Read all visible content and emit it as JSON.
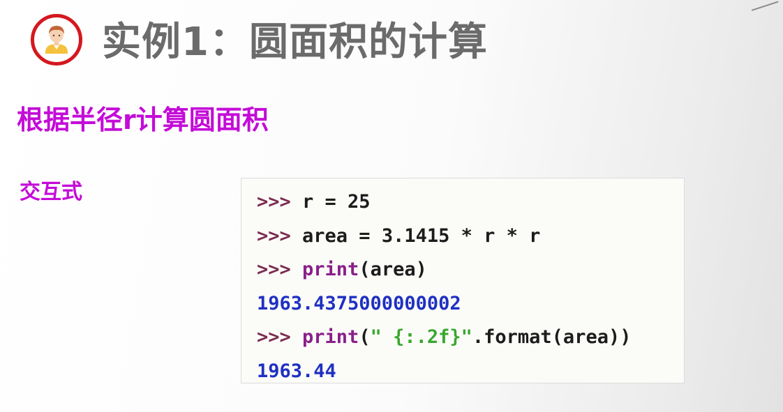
{
  "slide": {
    "title": "实例1：圆面积的计算",
    "subtitle": "根据半径r计算圆面积",
    "mode_label": "交互式"
  },
  "avatar": {
    "icon": "person-avatar-icon",
    "ring_color": "#d4181f"
  },
  "code": {
    "lines": [
      {
        "type": "input",
        "tokens": [
          {
            "kind": "prompt",
            "text": ">>> "
          },
          {
            "kind": "plain",
            "text": "r = 25"
          }
        ]
      },
      {
        "type": "input",
        "tokens": [
          {
            "kind": "prompt",
            "text": ">>> "
          },
          {
            "kind": "plain",
            "text": "area = 3.1415 * r * r"
          }
        ]
      },
      {
        "type": "input",
        "tokens": [
          {
            "kind": "prompt",
            "text": ">>> "
          },
          {
            "kind": "func",
            "text": "print"
          },
          {
            "kind": "plain",
            "text": "(area)"
          }
        ]
      },
      {
        "type": "output",
        "tokens": [
          {
            "kind": "output",
            "text": "1963.4375000000002"
          }
        ]
      },
      {
        "type": "input",
        "tokens": [
          {
            "kind": "prompt",
            "text": ">>> "
          },
          {
            "kind": "func",
            "text": "print"
          },
          {
            "kind": "plain",
            "text": "("
          },
          {
            "kind": "string",
            "text": "\" {:.2f}\""
          },
          {
            "kind": "plain",
            "text": ".format(area))"
          }
        ]
      },
      {
        "type": "output",
        "tokens": [
          {
            "kind": "output",
            "text": "1963.44"
          }
        ]
      }
    ]
  },
  "colors": {
    "title": "#6b6b6b",
    "accent": "#c40bd8",
    "prompt": "#7b2b50",
    "function": "#8a1f8a",
    "string": "#3aa72f",
    "output": "#1f30c2"
  }
}
